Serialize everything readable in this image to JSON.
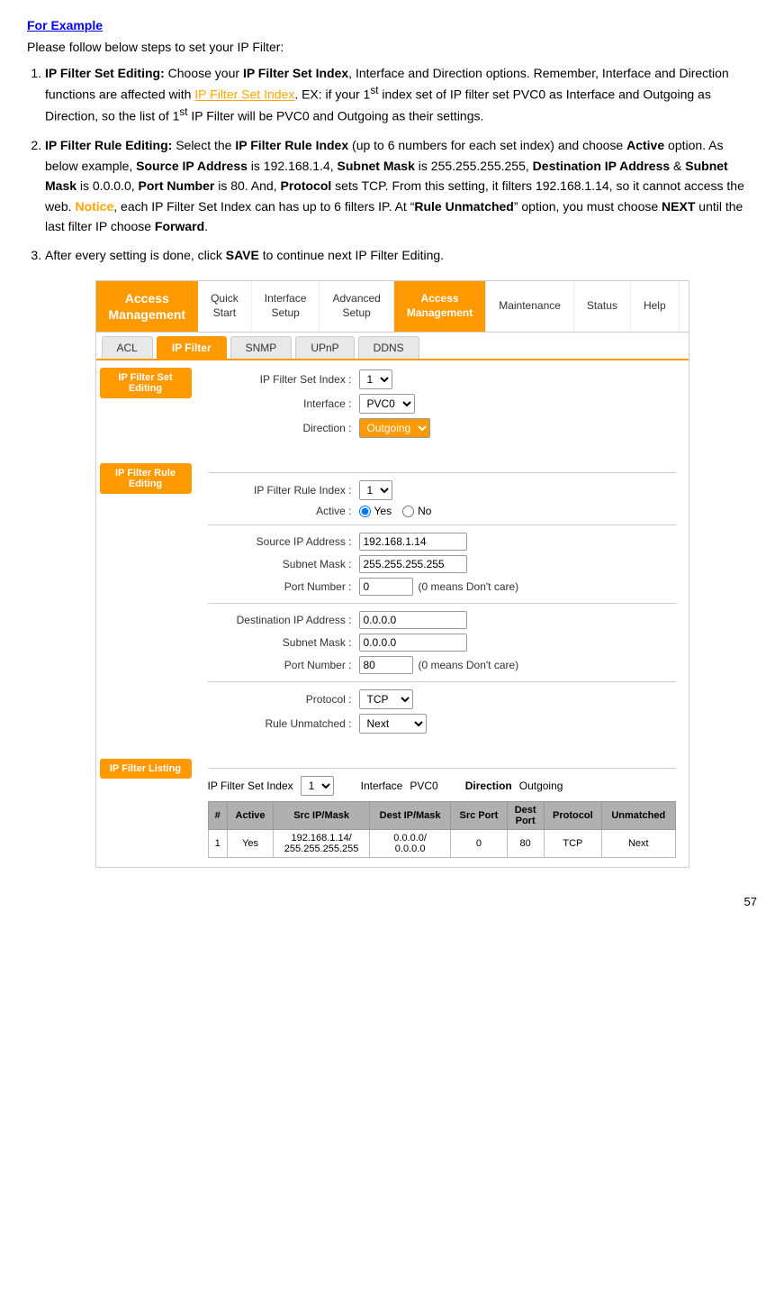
{
  "title": {
    "for_example": "For Example"
  },
  "intro": "Please follow below steps to set your IP Filter:",
  "steps": [
    {
      "label": "IP Filter Set Editing:",
      "text_before": " Choose your ",
      "bold1": "IP Filter Set Index",
      "text2": ", Interface and Direction options. Remember, Interface and Direction functions are affected with",
      "link": " IP Filter Set Index",
      "text3": ". EX: if your 1",
      "sup1": "st",
      "text4": " index set of IP filter set PVC0 as Interface and Outgoing as Direction, so the list of 1",
      "sup2": "st",
      "text5": " IP Filter will be PVC0 and Outgoing as their settings."
    },
    {
      "label": "IP Filter Rule Editing:",
      "text1": " Select the ",
      "bold1": "IP Filter Rule Index",
      "text2": " (up to 6 numbers for each set index) and choose ",
      "bold2": "Active",
      "text3": " option.  As below example, ",
      "bold3": "Source IP Address",
      "text4": " is  192.168.1.4, ",
      "bold4": "Subnet Mask",
      "text5": " is  255.255.255.255, ",
      "bold5": "Destination IP Address",
      "text6": " & ",
      "bold6": "Subnet Mask",
      "text7": " is  0.0.0.0, ",
      "bold7": "Port Number",
      "text8": " is 80. And, ",
      "bold8": "Protocol",
      "text9": " sets TCP. From this setting, it filters 192.168.1.14, so it cannot access the web. ",
      "orange": "Notice",
      "text10": ", each IP Filter Set Index can has up to 6 filters IP. At “",
      "bold9": "Rule Unmatched",
      "text11": "” option, you must choose ",
      "bold10": "NEXT",
      "text12": " until the last filter IP choose ",
      "bold11": "Forward",
      "text13": "."
    },
    {
      "text": "After every setting is done, click ",
      "bold1": "SAVE",
      "text2": " to continue next IP Filter Editing."
    }
  ],
  "router": {
    "brand": "Access\nManagement",
    "nav": [
      {
        "label": "Quick\nStart",
        "active": false
      },
      {
        "label": "Interface\nSetup",
        "active": false
      },
      {
        "label": "Advanced\nSetup",
        "active": false
      },
      {
        "label": "Access\nManagement",
        "active": true
      },
      {
        "label": "Maintenance",
        "active": false
      },
      {
        "label": "Status",
        "active": false
      },
      {
        "label": "Help",
        "active": false
      }
    ],
    "tabs": [
      {
        "label": "ACL",
        "active": false
      },
      {
        "label": "IP Filter",
        "active": true
      },
      {
        "label": "SNMP",
        "active": false
      },
      {
        "label": "UPnP",
        "active": false
      },
      {
        "label": "DDNS",
        "active": false
      }
    ],
    "sidebar_top": "IP Filter Set Editing",
    "sidebar_rule": "IP Filter Rule Editing",
    "sidebar_listing": "IP Filter Listing",
    "set_editing": {
      "index_label": "IP Filter Set Index :",
      "index_value": "1",
      "interface_label": "Interface :",
      "interface_value": "PVC0",
      "direction_label": "Direction :",
      "direction_value": "Outgoing"
    },
    "rule_editing": {
      "index_label": "IP Filter Rule Index :",
      "index_value": "1",
      "active_label": "Active :",
      "active_yes": "Yes",
      "active_no": "No",
      "src_ip_label": "Source IP Address :",
      "src_ip_value": "192.168.1.14",
      "src_mask_label": "Subnet Mask :",
      "src_mask_value": "255.255.255.255",
      "src_port_label": "Port Number :",
      "src_port_value": "0",
      "src_port_note": "(0 means Don't care)",
      "dest_ip_label": "Destination IP Address :",
      "dest_ip_value": "0.0.0.0",
      "dest_mask_label": "Subnet Mask :",
      "dest_mask_value": "0.0.0.0",
      "dest_port_label": "Port Number :",
      "dest_port_value": "80",
      "dest_port_note": "(0 means Don't care)",
      "protocol_label": "Protocol :",
      "protocol_value": "TCP",
      "rule_unmatched_label": "Rule Unmatched :",
      "rule_unmatched_value": "Next"
    },
    "listing": {
      "index_label": "IP Filter Set Index",
      "index_value": "1",
      "interface_label": "Interface",
      "interface_value": "PVC0",
      "direction_label": "Direction",
      "direction_value": "Outgoing",
      "table_headers": [
        "#",
        "Active",
        "Src IP/Mask",
        "Dest IP/Mask",
        "Src Port",
        "Dest Port",
        "Protocol",
        "Unmatched"
      ],
      "rows": [
        {
          "num": "1",
          "active": "Yes",
          "src_ip": "192.168.1.14/\n255.255.255.255",
          "dest_ip": "0.0.0.0/\n0.0.0.0",
          "src_port": "0",
          "dest_port": "80",
          "protocol": "TCP",
          "unmatched": "Next"
        }
      ]
    }
  },
  "page_number": "57"
}
